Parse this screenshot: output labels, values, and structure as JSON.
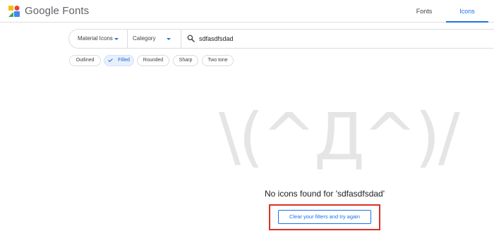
{
  "header": {
    "brand": "Google Fonts",
    "tabs": [
      {
        "label": "Fonts",
        "active": false
      },
      {
        "label": "Icons",
        "active": true
      }
    ]
  },
  "toolbar": {
    "icon_set": "Material Icons",
    "category": "Category",
    "search_value": "sdfasdfsdad"
  },
  "styles": [
    {
      "label": "Outlined",
      "selected": false
    },
    {
      "label": "Filled",
      "selected": true
    },
    {
      "label": "Rounded",
      "selected": false
    },
    {
      "label": "Sharp",
      "selected": false
    },
    {
      "label": "Two tone",
      "selected": false
    }
  ],
  "empty_state": {
    "kaomoji": "\\(^Д^)/",
    "message": "No icons found for 'sdfasdfsdad'",
    "button": "Clear your filters and try again"
  },
  "colors": {
    "accent": "#1a73e8",
    "highlight": "#d93025"
  },
  "icons": {
    "logo": "google-fonts-logo-icon",
    "search": "search-icon",
    "dropdown": "chevron-down-icon",
    "check": "check-icon"
  }
}
